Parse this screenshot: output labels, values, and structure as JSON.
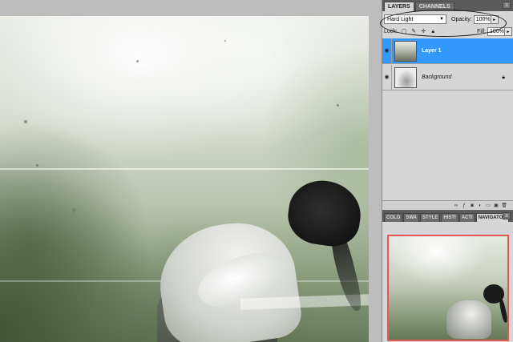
{
  "layers_panel": {
    "tabs": [
      {
        "label": "LAYERS",
        "active": true
      },
      {
        "label": "CHANNELS",
        "active": false
      }
    ],
    "blend_mode": "Hard Light",
    "opacity_label": "Opacity:",
    "opacity_value": "100%",
    "lock_label": "Lock:",
    "fill_label": "Fill:",
    "fill_value": "100%",
    "layers": [
      {
        "name": "Layer 1",
        "selected": true,
        "visible": true
      },
      {
        "name": "Background",
        "selected": false,
        "visible": true,
        "locked": true
      }
    ]
  },
  "nav_panel": {
    "tabs": [
      {
        "label": "COLO",
        "active": false
      },
      {
        "label": "SWA",
        "active": false
      },
      {
        "label": "STYLE",
        "active": false
      },
      {
        "label": "HISTI",
        "active": false
      },
      {
        "label": "ACTI",
        "active": false
      },
      {
        "label": "NAVIGATOR",
        "active": true
      }
    ]
  },
  "colors": {
    "selection_blue": "#3399ff",
    "navigator_frame": "#e05858",
    "panel_bg": "#d6d6d6",
    "tabbar_bg": "#5a5a5a"
  }
}
